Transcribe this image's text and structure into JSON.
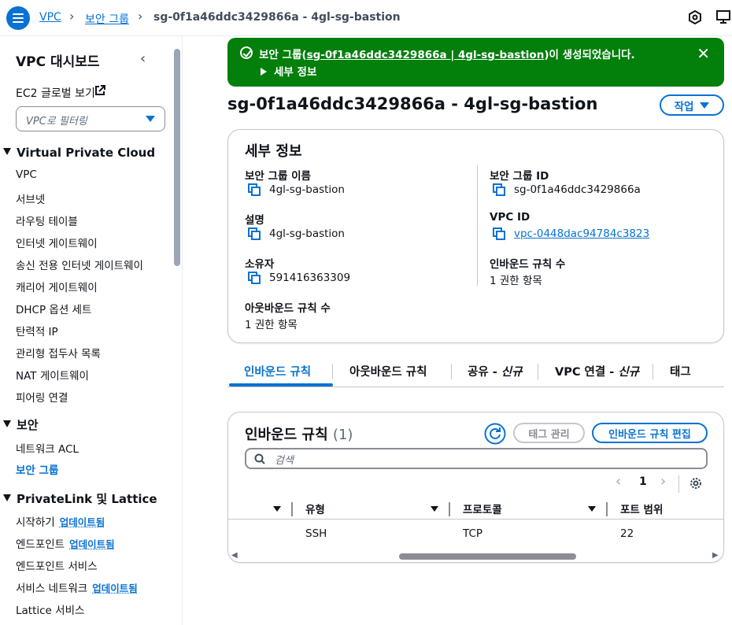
{
  "breadcrumb": {
    "items": [
      "VPC",
      "보안 그룹",
      "sg-0f1a46ddc3429866a - 4gl-sg-bastion"
    ]
  },
  "sidebar": {
    "title": "VPC 대시보드",
    "ec2_global_view": "EC2 글로벌 보기",
    "filter_placeholder": "VPC로 필터링",
    "sections": {
      "vpc": "Virtual Private Cloud",
      "security": "보안",
      "privatelink": "PrivateLink 및 Lattice"
    },
    "vpc_items": [
      "VPC",
      "서브넷",
      "라우팅 테이블",
      "인터넷 게이트웨이",
      "송신 전용 인터넷 게이트웨이",
      "캐리어 게이트웨이",
      "DHCP 옵션 세트",
      "탄력적 IP",
      "관리형 접두사 목록",
      "NAT 게이트웨이",
      "피어링 연결"
    ],
    "security_items": [
      "네트워크 ACL",
      "보안 그룹"
    ],
    "privatelink_items": [
      "시작하기",
      "엔드포인트",
      "엔드포인트 서비스",
      "서비스 네트워크",
      "Lattice 서비스"
    ],
    "updated_badge": "업데이트됨"
  },
  "flash": {
    "prefix": "보안 그룹(",
    "link": "sg-0f1a46ddc3429866a | 4gl-sg-bastion",
    "suffix": ")이 생성되었습니다.",
    "details": "세부 정보",
    "close": "✕"
  },
  "page": {
    "title": "sg-0f1a46ddc3429866a - 4gl-sg-bastion",
    "actions_label": "작업"
  },
  "details": {
    "heading": "세부 정보",
    "fields": {
      "sg_name_label": "보안 그룹 이름",
      "sg_name_value": "4gl-sg-bastion",
      "sg_id_label": "보안 그룹 ID",
      "sg_id_value": "sg-0f1a46ddc3429866a",
      "description_label": "설명",
      "description_value": "4gl-sg-bastion",
      "vpc_id_label": "VPC ID",
      "vpc_id_value": "vpc-0448dac94784c3823",
      "owner_label": "소유자",
      "owner_value": "591416363309",
      "inbound_count_label": "인바운드 규칙 수",
      "inbound_count_value": "1 권한 항목",
      "outbound_count_label": "아웃바운드 규칙 수",
      "outbound_count_value": "1 권한 항목"
    }
  },
  "tabs": [
    {
      "label": "인바운드 규칙",
      "suffix": ""
    },
    {
      "label": "아웃바운드 규칙",
      "suffix": ""
    },
    {
      "label": "공유 - ",
      "suffix": "신규"
    },
    {
      "label": "VPC 연결 - ",
      "suffix": "신규"
    },
    {
      "label": "태그",
      "suffix": ""
    }
  ],
  "rules": {
    "heading": "인바운드 규칙",
    "count": "(1)",
    "manage_tags": "태그 관리",
    "edit_rules": "인바운드 규칙 편집",
    "search_placeholder": "검색",
    "page": "1",
    "columns": [
      "유형",
      "프로토콜",
      "포트 범위"
    ],
    "rows": [
      {
        "type": "SSH",
        "protocol": "TCP",
        "port": "22"
      }
    ]
  },
  "colors": {
    "accent": "#0972d3",
    "success": "#037f0c",
    "text": "#0f141a"
  }
}
